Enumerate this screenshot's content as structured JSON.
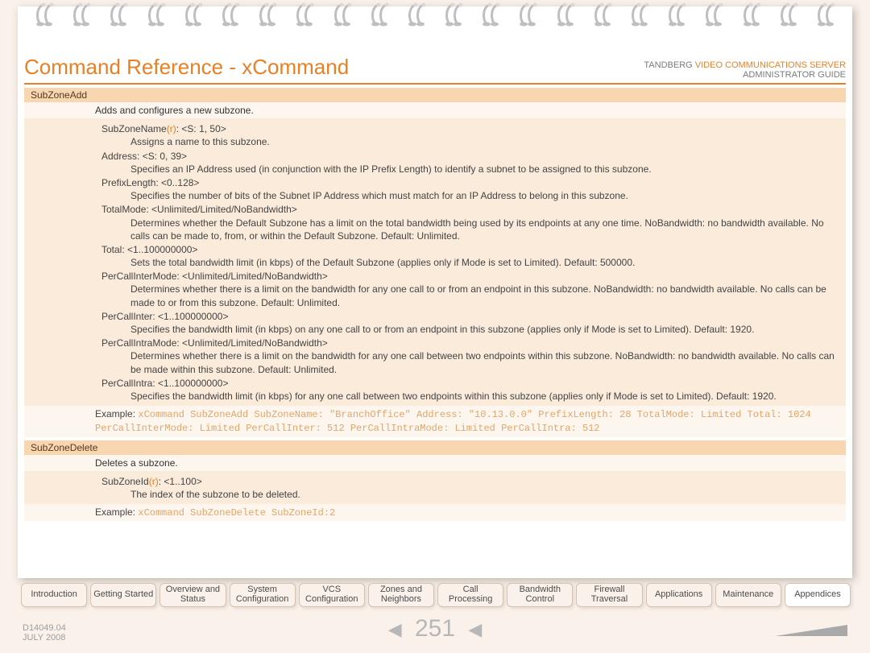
{
  "title": "Command Reference - xCommand",
  "brand": {
    "vendor": "TANDBERG",
    "product": "VIDEO COMMUNICATIONS SERVER",
    "subtitle": "ADMINISTRATOR GUIDE"
  },
  "commands": [
    {
      "name": "SubZoneAdd",
      "desc": "Adds and configures a new subzone.",
      "params": [
        {
          "sig_pre": "SubZoneName",
          "sig_req": "(r)",
          "sig_post": ": <S: 1, 50>",
          "desc": "Assigns a name to this subzone."
        },
        {
          "sig_pre": "Address: <S: 0, 39>",
          "sig_req": "",
          "sig_post": "",
          "desc": "Specifies an IP Address used (in conjunction with the IP Prefix Length) to identify a subnet to be assigned to this subzone."
        },
        {
          "sig_pre": "PrefixLength: <0..128>",
          "sig_req": "",
          "sig_post": "",
          "desc": "Specifies the number of bits of the Subnet IP Address which must match for an IP Address to belong in this subzone."
        },
        {
          "sig_pre": "TotalMode: <Unlimited/Limited/NoBandwidth>",
          "sig_req": "",
          "sig_post": "",
          "desc": "Determines whether the Default Subzone has a limit on the total bandwidth being used by its endpoints at any one time. NoBandwidth: no bandwidth available. No calls can be made to, from, or within the Default Subzone. Default: Unlimited."
        },
        {
          "sig_pre": "Total: <1..100000000>",
          "sig_req": "",
          "sig_post": "",
          "desc": "Sets the total bandwidth limit (in kbps) of the Default Subzone (applies only if Mode is set to Limited). Default: 500000."
        },
        {
          "sig_pre": "PerCallInterMode: <Unlimited/Limited/NoBandwidth>",
          "sig_req": "",
          "sig_post": "",
          "desc": "Determines whether there is a limit on the bandwidth for any one call to or from an endpoint in this subzone. NoBandwidth: no bandwidth available. No calls can be made to or from this subzone. Default: Unlimited."
        },
        {
          "sig_pre": "PerCallInter: <1..100000000>",
          "sig_req": "",
          "sig_post": "",
          "desc": "Specifies the bandwidth limit (in kbps) on any one call to or from an endpoint in this subzone (applies only if Mode is set to Limited). Default: 1920."
        },
        {
          "sig_pre": "PerCallIntraMode: <Unlimited/Limited/NoBandwidth>",
          "sig_req": "",
          "sig_post": "",
          "desc": "Determines whether there is a limit on the bandwidth for any one call between two endpoints within this subzone. NoBandwidth: no bandwidth available. No calls can be made within this subzone. Default: Unlimited."
        },
        {
          "sig_pre": "PerCallIntra: <1..100000000>",
          "sig_req": "",
          "sig_post": "",
          "desc": "Specifies the bandwidth limit (in kbps) for any one call between two endpoints within this subzone (applies only if Mode is set to Limited). Default: 1920."
        }
      ],
      "example_label": "Example:",
      "example": "xCommand SubZoneAdd SubZoneName: \"BranchOffice\" Address: \"10.13.0.0\" PrefixLength: 28 TotalMode: Limited Total: 1024 PerCallInterMode: Limited PerCallInter: 512 PerCallIntraMode: Limited PerCallIntra: 512"
    },
    {
      "name": "SubZoneDelete",
      "desc": "Deletes a subzone.",
      "params": [
        {
          "sig_pre": "SubZoneId",
          "sig_req": "(r)",
          "sig_post": ": <1..100>",
          "desc": "The index of the subzone to be deleted."
        }
      ],
      "example_label": "Example:",
      "example": "xCommand SubZoneDelete SubZoneId:2"
    }
  ],
  "tabs": [
    {
      "l1": "Introduction",
      "l2": ""
    },
    {
      "l1": "Getting Started",
      "l2": ""
    },
    {
      "l1": "Overview and",
      "l2": "Status"
    },
    {
      "l1": "System",
      "l2": "Configuration"
    },
    {
      "l1": "VCS",
      "l2": "Configuration"
    },
    {
      "l1": "Zones and",
      "l2": "Neighbors"
    },
    {
      "l1": "Call",
      "l2": "Processing"
    },
    {
      "l1": "Bandwidth",
      "l2": "Control"
    },
    {
      "l1": "Firewall",
      "l2": "Traversal"
    },
    {
      "l1": "Applications",
      "l2": ""
    },
    {
      "l1": "Maintenance",
      "l2": ""
    },
    {
      "l1": "Appendices",
      "l2": ""
    }
  ],
  "active_tab": 11,
  "doc_id": "D14049.04",
  "doc_date": "JULY 2008",
  "page_number": "251"
}
